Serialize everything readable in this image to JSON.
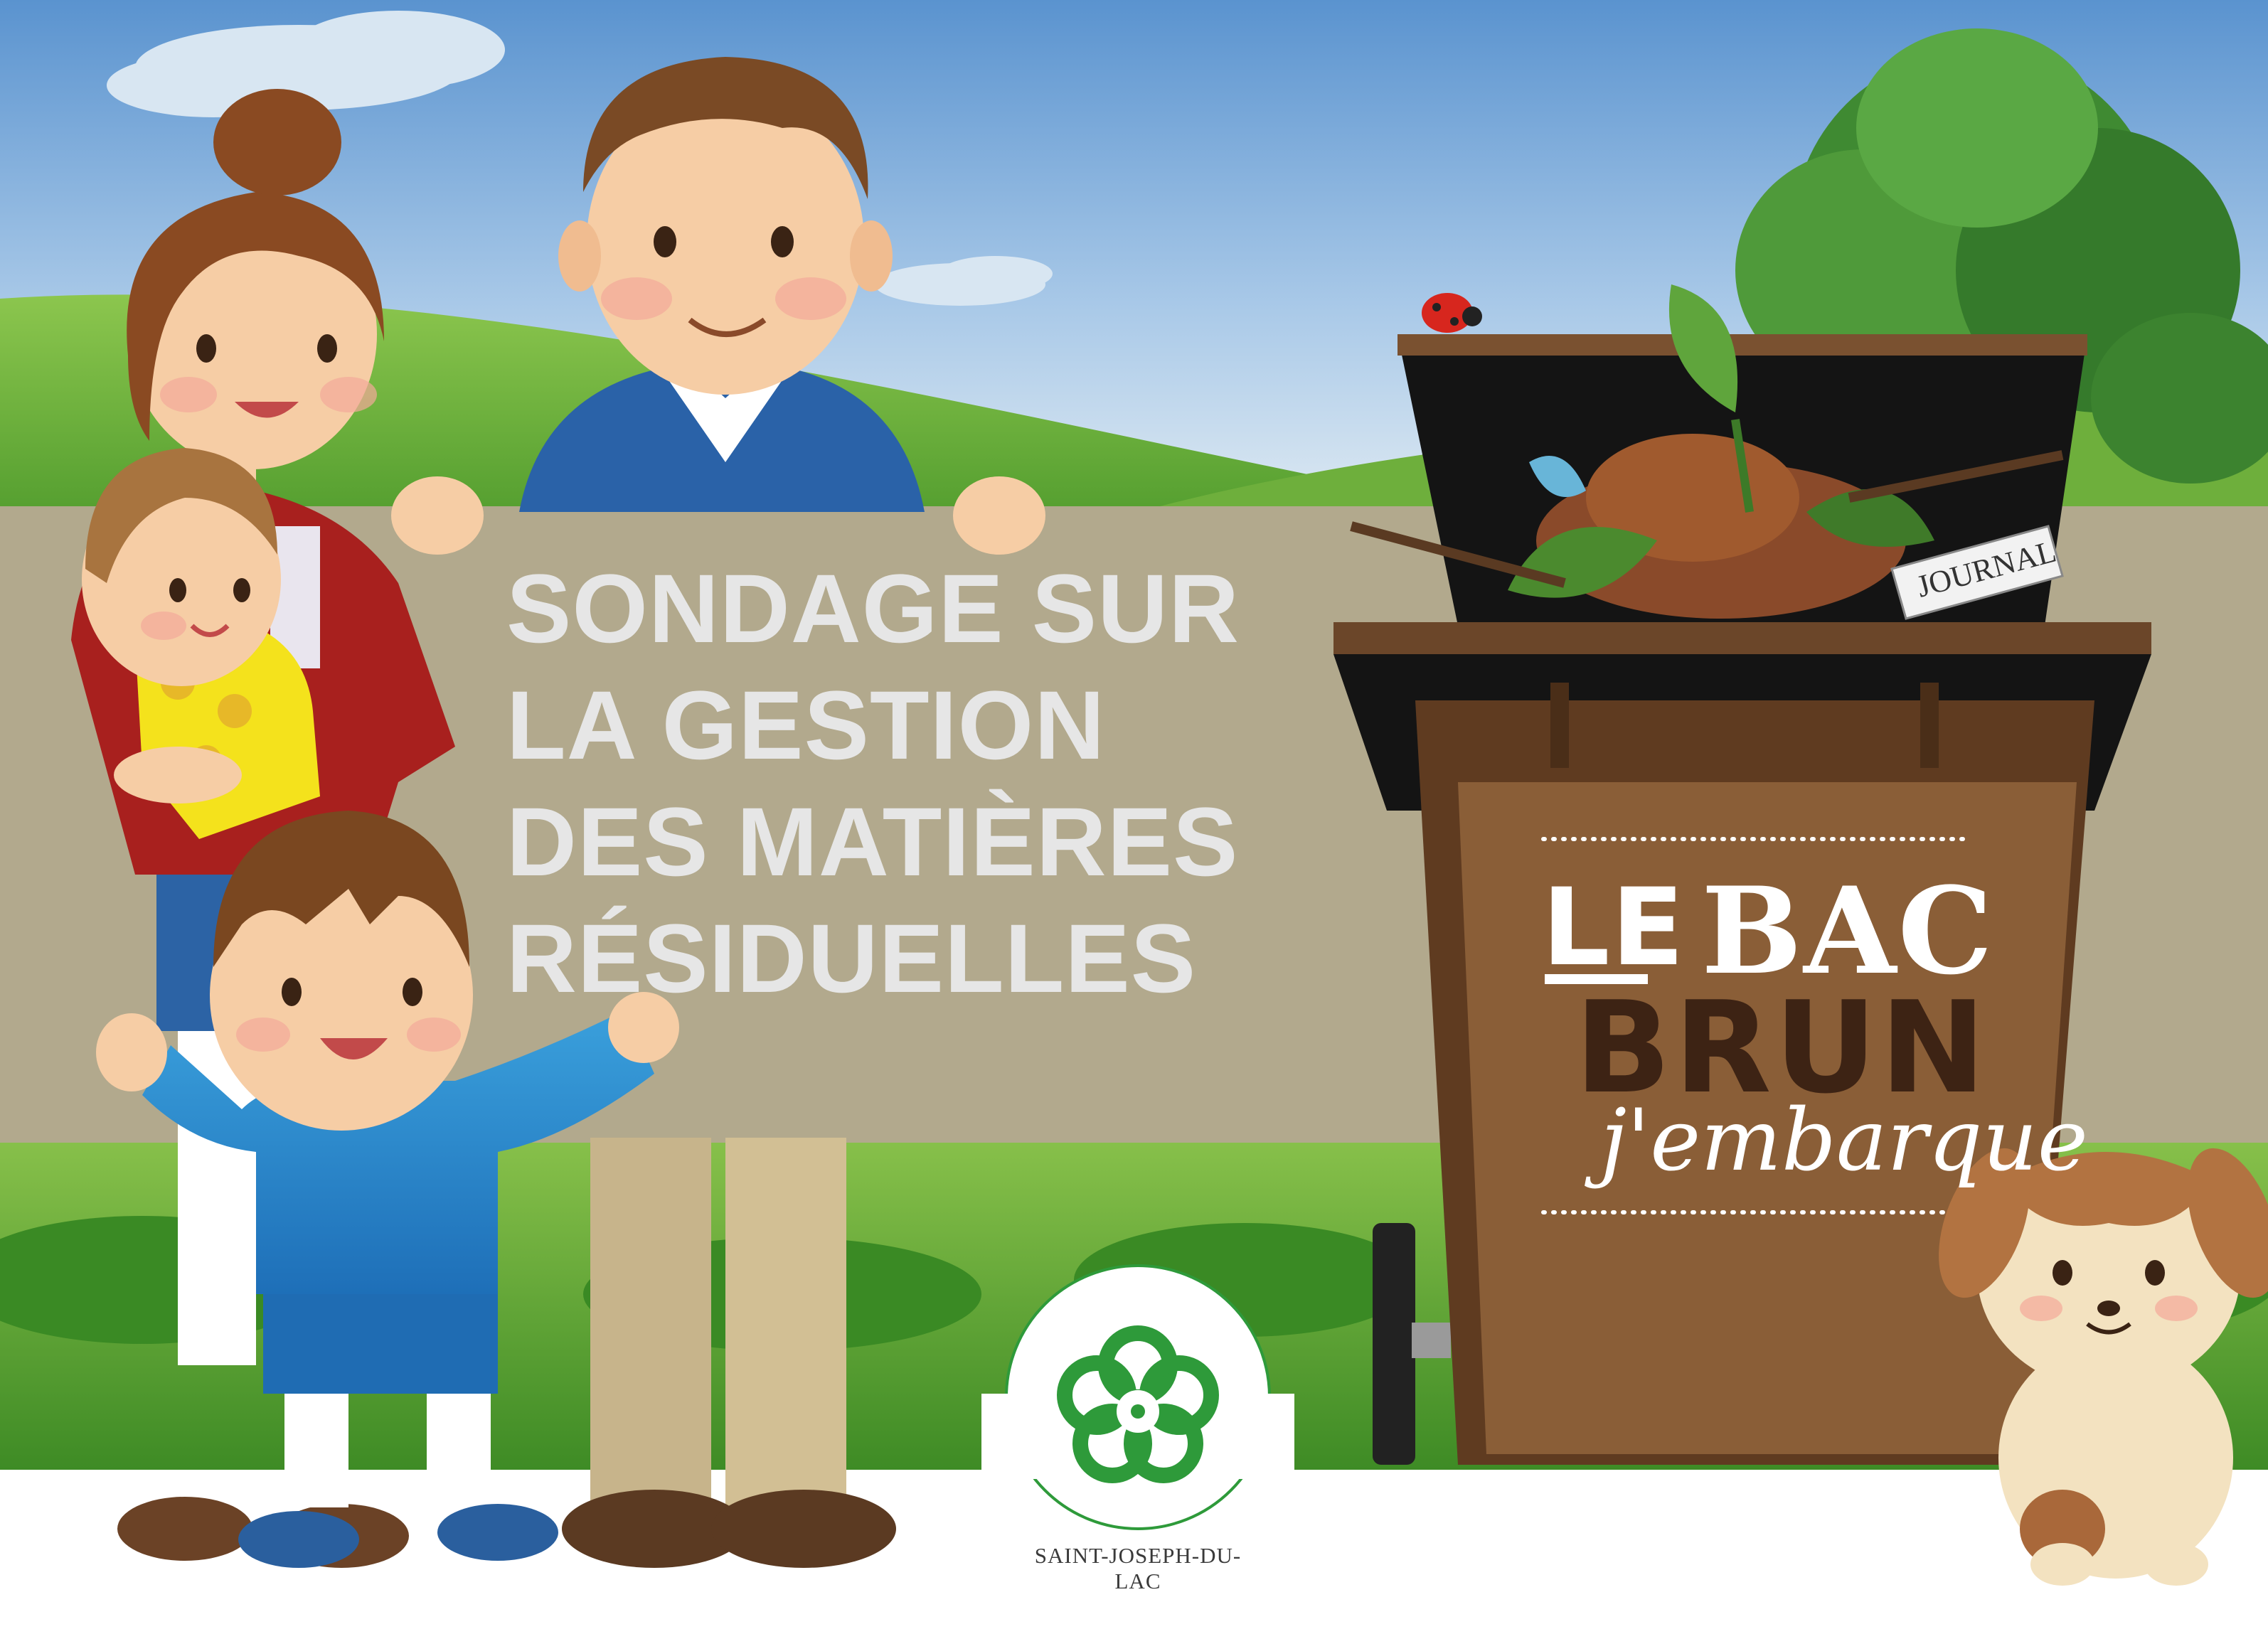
{
  "headline": {
    "lines": [
      "SONDAGE SUR",
      "LA GESTION",
      "DES MATIÈRES",
      "RÉSIDUELLES"
    ]
  },
  "brand": {
    "le": "LE",
    "bac": "BAC",
    "brun": "BRUN",
    "tagline": "j'embarque"
  },
  "bin": {
    "newspaper_text": "JOURNAL"
  },
  "municipality": {
    "name": "SAINT-JOSEPH-DU-LAC"
  },
  "colors": {
    "sky": "#b9d3ea",
    "banner": "#b2a98d",
    "bin_brown": "#8a5e37",
    "dark_brown": "#3d2314",
    "logo_green": "#2e9a3a",
    "headline_text": "#e6e6e6"
  }
}
